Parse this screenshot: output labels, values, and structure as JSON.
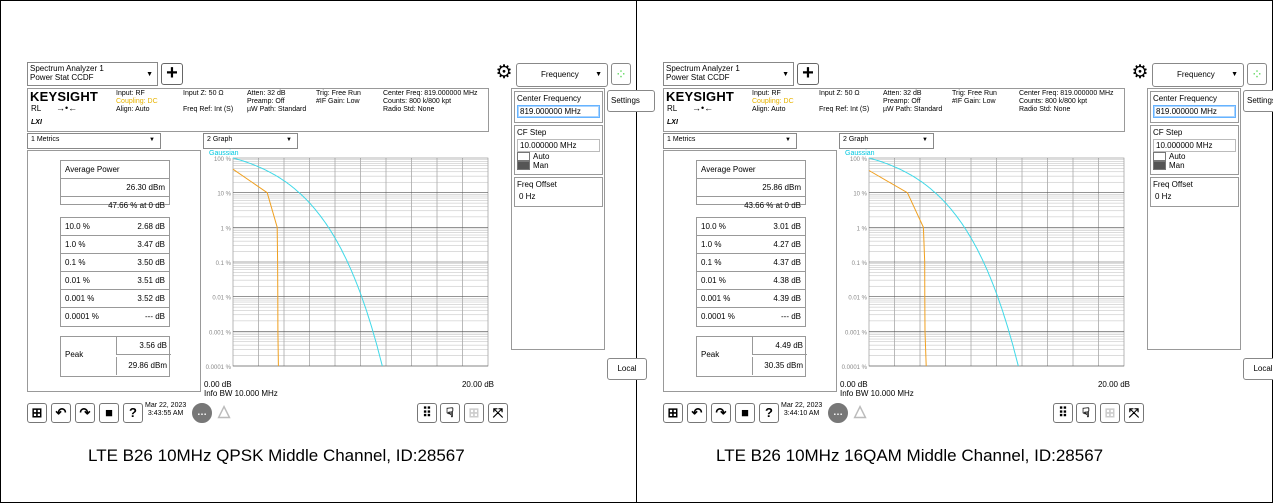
{
  "screens": [
    {
      "title_line1": "Spectrum Analyzer 1",
      "title_line2": "Power Stat CCDF",
      "brand": "KEYSIGHT",
      "rl": "RL",
      "lxi": "LXI",
      "input": "Input: RF",
      "coupling": "Coupling: DC",
      "align": "Align: Auto",
      "input_z": "Input Z: 50 Ω",
      "freq_ref": "Freq Ref: Int (S)",
      "atten": "Atten: 32 dB",
      "preamp": "Preamp: Off",
      "uw_path": "µW Path: Standard",
      "trig": "Trig: Free Run",
      "if_gain": "#IF Gain: Low",
      "center_freq_hdr": "Center Freq: 819.000000 MHz",
      "counts": "Counts: 800 k/800 kpt",
      "radio_std": "Radio Std: None",
      "menu_label": "Frequency",
      "settings": "Settings",
      "center_frequency_label": "Center Frequency",
      "center_frequency_value": "819.000000 MHz",
      "cf_step_label": "CF Step",
      "cf_step_value": "10.000000 MHz",
      "auto": "Auto",
      "man": "Man",
      "freq_offset_label": "Freq Offset",
      "freq_offset_value": "0 Hz",
      "local": "Local",
      "metrics_tab": "1 Metrics",
      "graph_tab": "2 Graph",
      "avg_power_label": "Average Power",
      "avg_power_dbm": "26.30 dBm",
      "avg_power_pct": "47.66 % at 0 dB",
      "rows": [
        {
          "k": "10.0 %",
          "v": "2.68 dB"
        },
        {
          "k": "1.0 %",
          "v": "3.47 dB"
        },
        {
          "k": "0.1 %",
          "v": "3.50 dB"
        },
        {
          "k": "0.01 %",
          "v": "3.51 dB"
        },
        {
          "k": "0.001 %",
          "v": "3.52 dB"
        },
        {
          "k": "0.0001 %",
          "v": "--- dB"
        }
      ],
      "peak_label": "Peak",
      "peak_db": "3.56 dB",
      "peak_dbm": "29.86 dBm",
      "legend": "Gaussian",
      "y_ticks": [
        "100 %",
        "10 %",
        "1 %",
        "0.1 %",
        "0.01 %",
        "0.001 %",
        "0.0001 %"
      ],
      "x_start": "0.00 dB",
      "x_end": "20.00 dB",
      "info_bw": "Info BW 10.000 MHz",
      "date": "Mar 22, 2023",
      "time": "3:43:55 AM",
      "caption": "LTE B26 10MHz QPSK Middle Channel, ID:28567"
    },
    {
      "title_line1": "Spectrum Analyzer 1",
      "title_line2": "Power Stat CCDF",
      "brand": "KEYSIGHT",
      "rl": "RL",
      "lxi": "LXI",
      "input": "Input: RF",
      "coupling": "Coupling: DC",
      "align": "Align: Auto",
      "input_z": "Input Z: 50 Ω",
      "freq_ref": "Freq Ref: Int (S)",
      "atten": "Atten: 32 dB",
      "preamp": "Preamp: Off",
      "uw_path": "µW Path: Standard",
      "trig": "Trig: Free Run",
      "if_gain": "#IF Gain: Low",
      "center_freq_hdr": "Center Freq: 819.000000 MHz",
      "counts": "Counts: 800 k/800 kpt",
      "radio_std": "Radio Std: None",
      "menu_label": "Frequency",
      "settings": "Settings",
      "center_frequency_label": "Center Frequency",
      "center_frequency_value": "819.000000 MHz",
      "cf_step_label": "CF Step",
      "cf_step_value": "10.000000 MHz",
      "auto": "Auto",
      "man": "Man",
      "freq_offset_label": "Freq Offset",
      "freq_offset_value": "0 Hz",
      "local": "Local",
      "metrics_tab": "1 Metrics",
      "graph_tab": "2 Graph",
      "avg_power_label": "Average Power",
      "avg_power_dbm": "25.86 dBm",
      "avg_power_pct": "43.66 % at 0 dB",
      "rows": [
        {
          "k": "10.0 %",
          "v": "3.01 dB"
        },
        {
          "k": "1.0 %",
          "v": "4.27 dB"
        },
        {
          "k": "0.1 %",
          "v": "4.37 dB"
        },
        {
          "k": "0.01 %",
          "v": "4.38 dB"
        },
        {
          "k": "0.001 %",
          "v": "4.39 dB"
        },
        {
          "k": "0.0001 %",
          "v": "--- dB"
        }
      ],
      "peak_label": "Peak",
      "peak_db": "4.49 dB",
      "peak_dbm": "30.35 dBm",
      "legend": "Gaussian",
      "y_ticks": [
        "100 %",
        "10 %",
        "1 %",
        "0.1 %",
        "0.01 %",
        "0.001 %",
        "0.0001 %"
      ],
      "x_start": "0.00 dB",
      "x_end": "20.00 dB",
      "info_bw": "Info BW 10.000 MHz",
      "date": "Mar 22, 2023",
      "time": "3:44:10 AM",
      "caption": "LTE B26 10MHz 16QAM Middle Channel, ID:28567"
    }
  ],
  "colors": {
    "gaussian_trace": "#3fd9e8",
    "signal_trace": "#f0a020",
    "coupling_text": "#e8b400"
  }
}
